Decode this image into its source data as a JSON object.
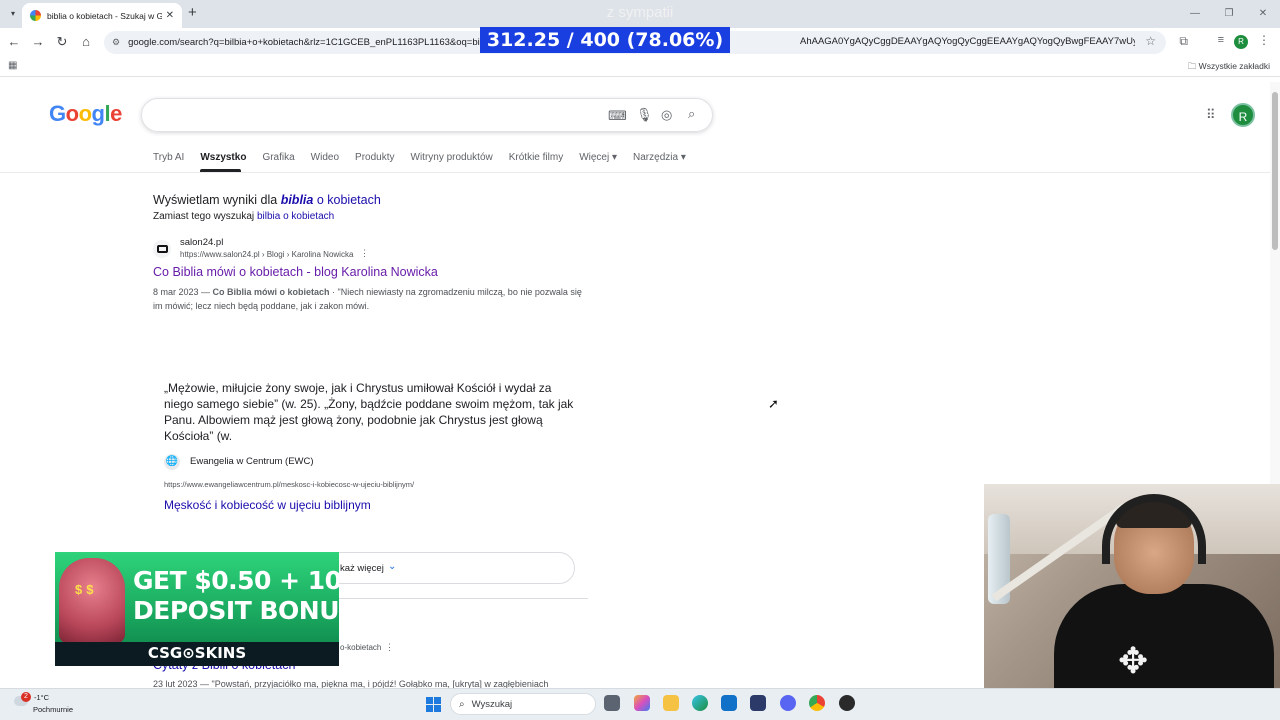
{
  "browser": {
    "tab_title": "biblia o kobietach - Szukaj w Go",
    "tab_close": "✕",
    "new_tab": "+",
    "url": "google.com/search?q=bilbia+o+kobietach&rlz=1C1GCEB_enPL1163PL1163&oq=bilb",
    "url_tail": "AhAAGA0YgAQyCggDEAAYgAQYogQyCggEEAAYgAQYogQyBwgFEAAY7wUyBwg...",
    "profile_initial": "R",
    "all_bookmarks": "Wszystkie zakładki"
  },
  "stream": {
    "title": "z sympatii",
    "counter": "312.25 / 400 (78.06%)"
  },
  "google": {
    "logo": [
      "G",
      "o",
      "o",
      "g",
      "l",
      "e"
    ],
    "avatar_initial": "R",
    "tabs": [
      {
        "label": "Tryb AI"
      },
      {
        "label": "Wszystko"
      },
      {
        "label": "Grafika"
      },
      {
        "label": "Wideo"
      },
      {
        "label": "Produkty"
      },
      {
        "label": "Witryny produktów"
      },
      {
        "label": "Krótkie filmy"
      },
      {
        "label": "Więcej ▾"
      },
      {
        "label": "Narzędzia ▾"
      }
    ],
    "spell": {
      "showing_prefix": "Wyświetlam wyniki dla ",
      "corrected_word": "biblia",
      "corrected_rest": " o kobietach",
      "instead_prefix": "Zamiast tego wyszukaj ",
      "instead_link": "bilbia o kobietach"
    },
    "result1": {
      "site": "salon24.pl",
      "crumb": "https://www.salon24.pl › Blogi › Karolina Nowicka",
      "title": "Co Biblia mówi o kobietach - blog Karolina Nowicka",
      "date": "8 mar 2023 — ",
      "bold": "Co Biblia mówi o kobietach",
      "snippet": " · \"Niech niewiasty na zgromadzeniu milczą, bo nie pozwala się im mówić; lecz niech będą poddane, jak i zakon mówi."
    },
    "featured": {
      "quote": "„Mężowie, miłujcie żony swoje, jak i Chrystus umiłował Kościół i wydał za niego samego siebie” (w. 25). „Żony, bądźcie poddane swoim mężom, tak jak Panu. Albowiem mąż jest głową żony, podobnie jak Chrystus jest głową Kościoła” (w.",
      "source": "Ewangelia w Centrum (EWC)",
      "url": "https://www.ewangeliawcentrum.pl/meskosc-i-kobiecosc-w-ujeciu-biblijnym/",
      "title": "Męskość i kobiecość w ujęciu biblijnym"
    },
    "show_more": "każ więcej",
    "result2": {
      "crumb": "o-kobietach",
      "title": "Cytaty z Biblii o kobietach",
      "snippet": "23 lut 2023 — \"Powstań, przyjaciółko ma, piękna ma, i pójdź! Gołąbko ma, [ukryta] w zagłębieniach"
    }
  },
  "ad": {
    "line1": "GET $0.50 + 10",
    "line2": "DEPOSIT BONU",
    "brand": "CSG⊙SKINS"
  },
  "taskbar": {
    "badge": "2",
    "temp": "-1°C",
    "weather": "Pochmurnie",
    "search_placeholder": "Wyszukaj"
  }
}
